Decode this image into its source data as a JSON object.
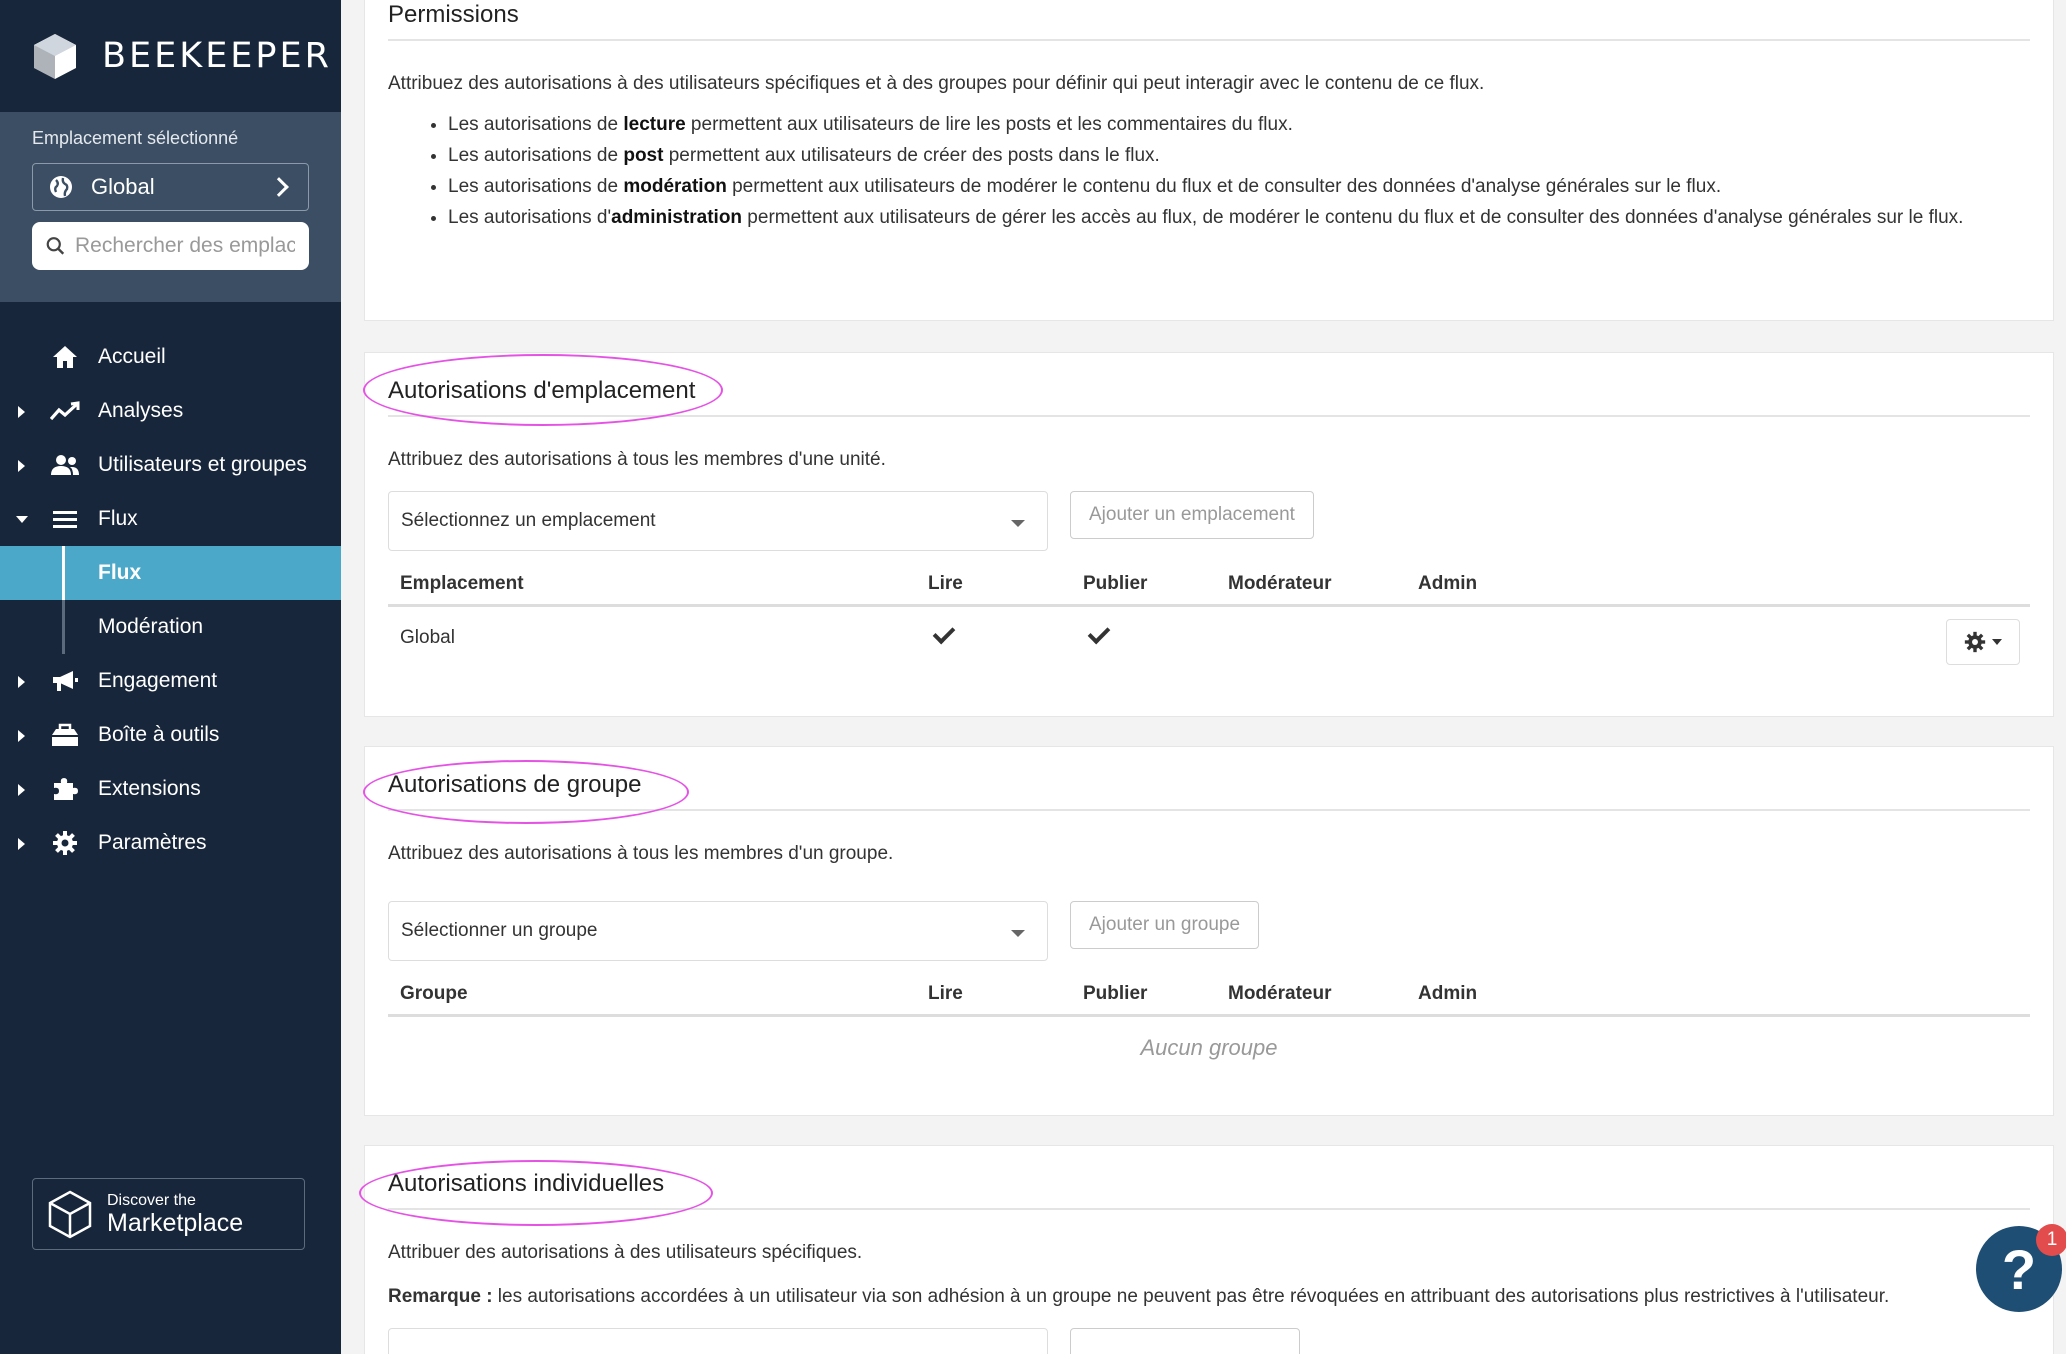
{
  "brand": {
    "name": "BEEKEEPER"
  },
  "location": {
    "label": "Emplacement sélectionné",
    "selected": "Global",
    "search_placeholder": "Rechercher des emplac"
  },
  "nav": {
    "accueil": "Accueil",
    "analyses": "Analyses",
    "users": "Utilisateurs et groupes",
    "flux": "Flux",
    "flux_sub": "Flux",
    "moderation": "Modération",
    "engagement": "Engagement",
    "toolbox": "Boîte à outils",
    "extensions": "Extensions",
    "settings": "Paramètres"
  },
  "marketplace": {
    "small": "Discover the",
    "big": "Marketplace"
  },
  "permissions": {
    "title": "Permissions",
    "desc": "Attribuez des autorisations à des utilisateurs spécifiques et à des groupes pour définir qui peut interagir avec le contenu de ce flux.",
    "items": [
      {
        "pre": "Les autorisations de ",
        "bold": "lecture",
        "post": " permettent aux utilisateurs de lire les posts et les commentaires du flux."
      },
      {
        "pre": "Les autorisations de ",
        "bold": "post",
        "post": " permettent aux utilisateurs de créer des posts dans le flux."
      },
      {
        "pre": "Les autorisations de ",
        "bold": "modération",
        "post": " permettent aux utilisateurs de modérer le contenu du flux et de consulter des données d'analyse générales sur le flux."
      },
      {
        "pre": "Les autorisations d'",
        "bold": "administration",
        "post": " permettent aux utilisateurs de gérer les accès au flux, de modérer le contenu du flux et de consulter des données d'analyse générales sur le flux."
      }
    ]
  },
  "location_perms": {
    "title": "Autorisations d'emplacement",
    "desc": "Attribuez des autorisations à tous les membres d'une unité.",
    "select_placeholder": "Sélectionnez un emplacement",
    "add_button": "Ajouter un emplacement",
    "headers": [
      "Emplacement",
      "Lire",
      "Publier",
      "Modérateur",
      "Admin"
    ],
    "rows": [
      {
        "name": "Global",
        "read": true,
        "publish": true,
        "moderator": false,
        "admin": false
      }
    ]
  },
  "group_perms": {
    "title": "Autorisations de groupe",
    "desc": "Attribuez des autorisations à tous les membres d'un groupe.",
    "select_placeholder": "Sélectionner un groupe",
    "add_button": "Ajouter un groupe",
    "headers": [
      "Groupe",
      "Lire",
      "Publier",
      "Modérateur",
      "Admin"
    ],
    "empty": "Aucun groupe"
  },
  "individual_perms": {
    "title": "Autorisations individuelles",
    "desc": "Attribuer des autorisations à des utilisateurs spécifiques.",
    "note_label": "Remarque :",
    "note_text": " les autorisations accordées à un utilisateur via son adhésion à un groupe ne peuvent pas être révoquées en attribuant des autorisations plus restrictives à l'utilisateur."
  },
  "help": {
    "label": "?",
    "badge": "1"
  },
  "colors": {
    "sidebar": "#17263a",
    "accent": "#4ba8c9",
    "highlight": "#e553e5"
  }
}
